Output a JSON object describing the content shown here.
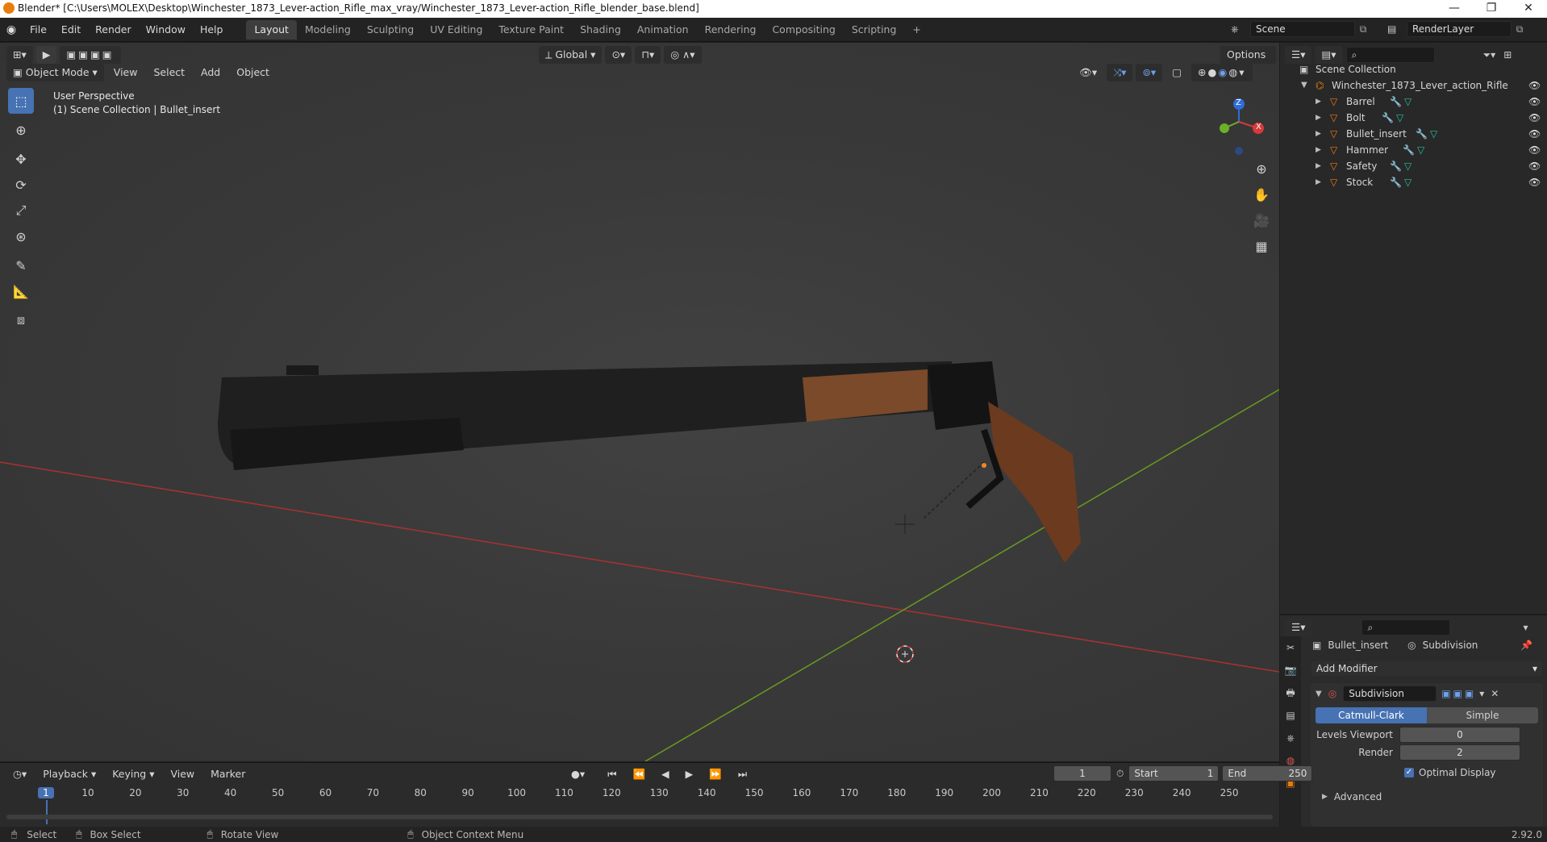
{
  "window": {
    "title": "Blender* [C:\\Users\\MOLEX\\Desktop\\Winchester_1873_Lever-action_Rifle_max_vray/Winchester_1873_Lever-action_Rifle_blender_base.blend]",
    "minimize": "—",
    "maximize": "❐",
    "close": "✕"
  },
  "menu": [
    "File",
    "Edit",
    "Render",
    "Window",
    "Help"
  ],
  "workspaces": [
    "Layout",
    "Modeling",
    "Sculpting",
    "UV Editing",
    "Texture Paint",
    "Shading",
    "Animation",
    "Rendering",
    "Compositing",
    "Scripting",
    "+"
  ],
  "active_workspace": "Layout",
  "scene": {
    "name": "Scene",
    "render_layer": "RenderLayer"
  },
  "viewport": {
    "transform_orientation": "Global",
    "options_label": "Options",
    "mode": "Object Mode",
    "header_menus": [
      "View",
      "Select",
      "Add",
      "Object"
    ],
    "overlay_text_1": "User Perspective",
    "overlay_text_2": "(1) Scene Collection | Bullet_insert",
    "gizmo_z": "Z",
    "gizmo_x": "X"
  },
  "outliner": {
    "root": "Scene Collection",
    "collection": "Winchester_1873_Lever_action_Rifle",
    "objects": [
      "Barrel",
      "Bolt",
      "Bullet_insert",
      "Hammer",
      "Safety",
      "Stock"
    ]
  },
  "properties": {
    "object": "Bullet_insert",
    "modifier_tab": "Subdivision",
    "add_modifier": "Add Modifier",
    "modifier_name": "Subdivision",
    "mode_a": "Catmull-Clark",
    "mode_b": "Simple",
    "levels_viewport_label": "Levels Viewport",
    "levels_viewport": "0",
    "render_label": "Render",
    "render_value": "2",
    "optimal_display": "Optimal Display",
    "advanced": "Advanced"
  },
  "timeline": {
    "menus": [
      "Playback",
      "Keying",
      "View",
      "Marker"
    ],
    "current_frame": "1",
    "start_label": "Start",
    "start": "1",
    "end_label": "End",
    "end": "250",
    "ticks": [
      "1",
      "10",
      "20",
      "30",
      "40",
      "50",
      "60",
      "70",
      "80",
      "90",
      "100",
      "110",
      "120",
      "130",
      "140",
      "150",
      "160",
      "170",
      "180",
      "190",
      "200",
      "210",
      "220",
      "230",
      "240",
      "250"
    ]
  },
  "status": {
    "select": "Select",
    "box_select": "Box Select",
    "rotate_view": "Rotate View",
    "context_menu": "Object Context Menu",
    "version": "2.92.0"
  },
  "colors": {
    "accent": "#4772b3",
    "object_orange": "#e87d0d",
    "axis_red": "#a83232",
    "axis_green": "#6b9a1e"
  }
}
